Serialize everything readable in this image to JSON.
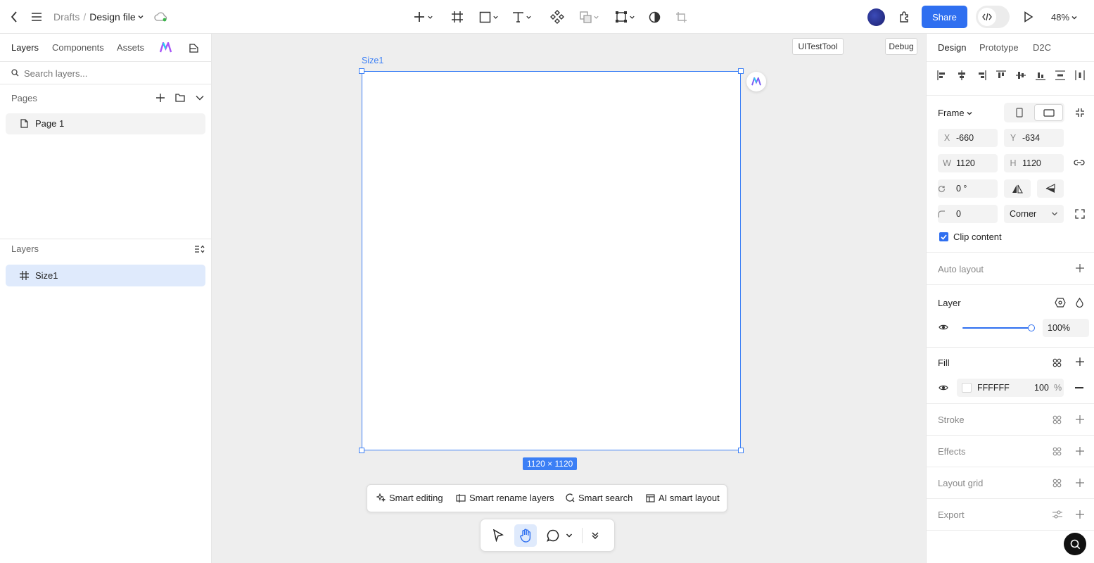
{
  "breadcrumb": {
    "parent": "Drafts",
    "separator": "/",
    "file": "Design file"
  },
  "header": {
    "share_label": "Share",
    "zoom": "48%"
  },
  "left_tabs": [
    "Layers",
    "Components",
    "Assets"
  ],
  "search": {
    "placeholder": "Search layers..."
  },
  "pages": {
    "title": "Pages",
    "items": [
      "Page 1"
    ]
  },
  "layers": {
    "title": "Layers",
    "items": [
      "Size1"
    ]
  },
  "canvas": {
    "frame_label": "Size1",
    "size_badge": "1120 × 1120",
    "uitest_label": "UITestTool",
    "debug_label": "Debug"
  },
  "ai_bar": {
    "smart_editing": "Smart editing",
    "smart_rename": "Smart rename layers",
    "smart_search": "Smart search",
    "ai_layout": "AI smart layout"
  },
  "right_tabs": [
    "Design",
    "Prototype",
    "D2C"
  ],
  "frame": {
    "title": "Frame",
    "x_label": "X",
    "x": "-660",
    "y_label": "Y",
    "y": "-634",
    "w_label": "W",
    "w": "1120",
    "h_label": "H",
    "h": "1120",
    "rotation": "0 °",
    "radius": "0",
    "corner": "Corner",
    "clip_content": "Clip content"
  },
  "auto_layout": {
    "title": "Auto layout"
  },
  "layer_section": {
    "title": "Layer",
    "opacity": "100%",
    "opacity_value": 1.0
  },
  "fill": {
    "title": "Fill",
    "hex": "FFFFFF",
    "opacity": "100",
    "unit": "%"
  },
  "sections": {
    "stroke": "Stroke",
    "effects": "Effects",
    "layout_grid": "Layout grid",
    "export": "Export"
  },
  "colors": {
    "accent": "#2f6ff0",
    "selection": "#3b7ff5",
    "selected_layer_bg": "#dfeafc"
  }
}
